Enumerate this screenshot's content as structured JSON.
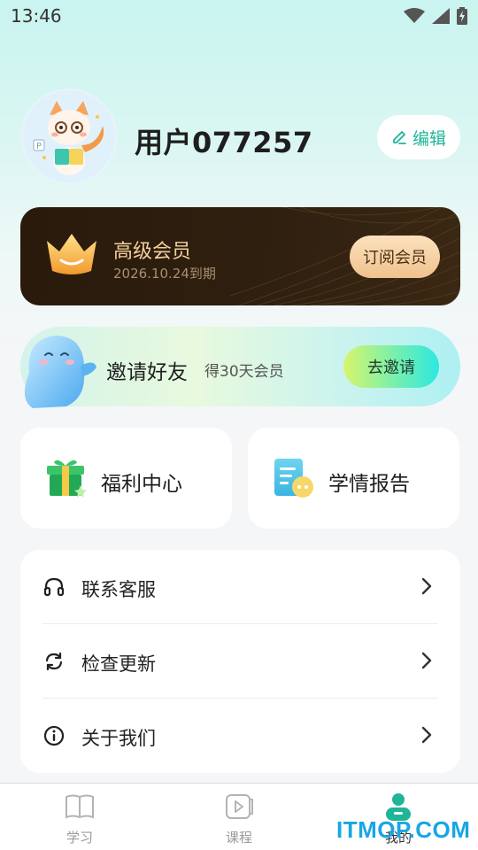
{
  "status_bar": {
    "time": "13:46"
  },
  "profile": {
    "username": "用户077257",
    "edit_label": "编辑"
  },
  "vip": {
    "title": "高级会员",
    "expire": "2026.10.24到期",
    "subscribe_label": "订阅会员"
  },
  "invite": {
    "title": "邀请好友",
    "subtitle": "得30天会员",
    "button_label": "去邀请"
  },
  "tiles": {
    "welfare": "福利中心",
    "report": "学情报告"
  },
  "menu": {
    "items": [
      {
        "label": "联系客服",
        "icon": "headset-icon"
      },
      {
        "label": "检查更新",
        "icon": "refresh-icon"
      },
      {
        "label": "关于我们",
        "icon": "info-icon"
      }
    ]
  },
  "tabbar": {
    "tabs": [
      {
        "label": "学习",
        "icon": "book-icon"
      },
      {
        "label": "课程",
        "icon": "video-icon"
      },
      {
        "label": "我的",
        "icon": "profile-icon",
        "active": true
      }
    ]
  },
  "watermark": "ITMOP.COM",
  "colors": {
    "accent": "#1eb59a",
    "vip_gold": "#f3cf9c",
    "vip_bg": "#2a1a0c",
    "tab_active": "#1fb598"
  }
}
